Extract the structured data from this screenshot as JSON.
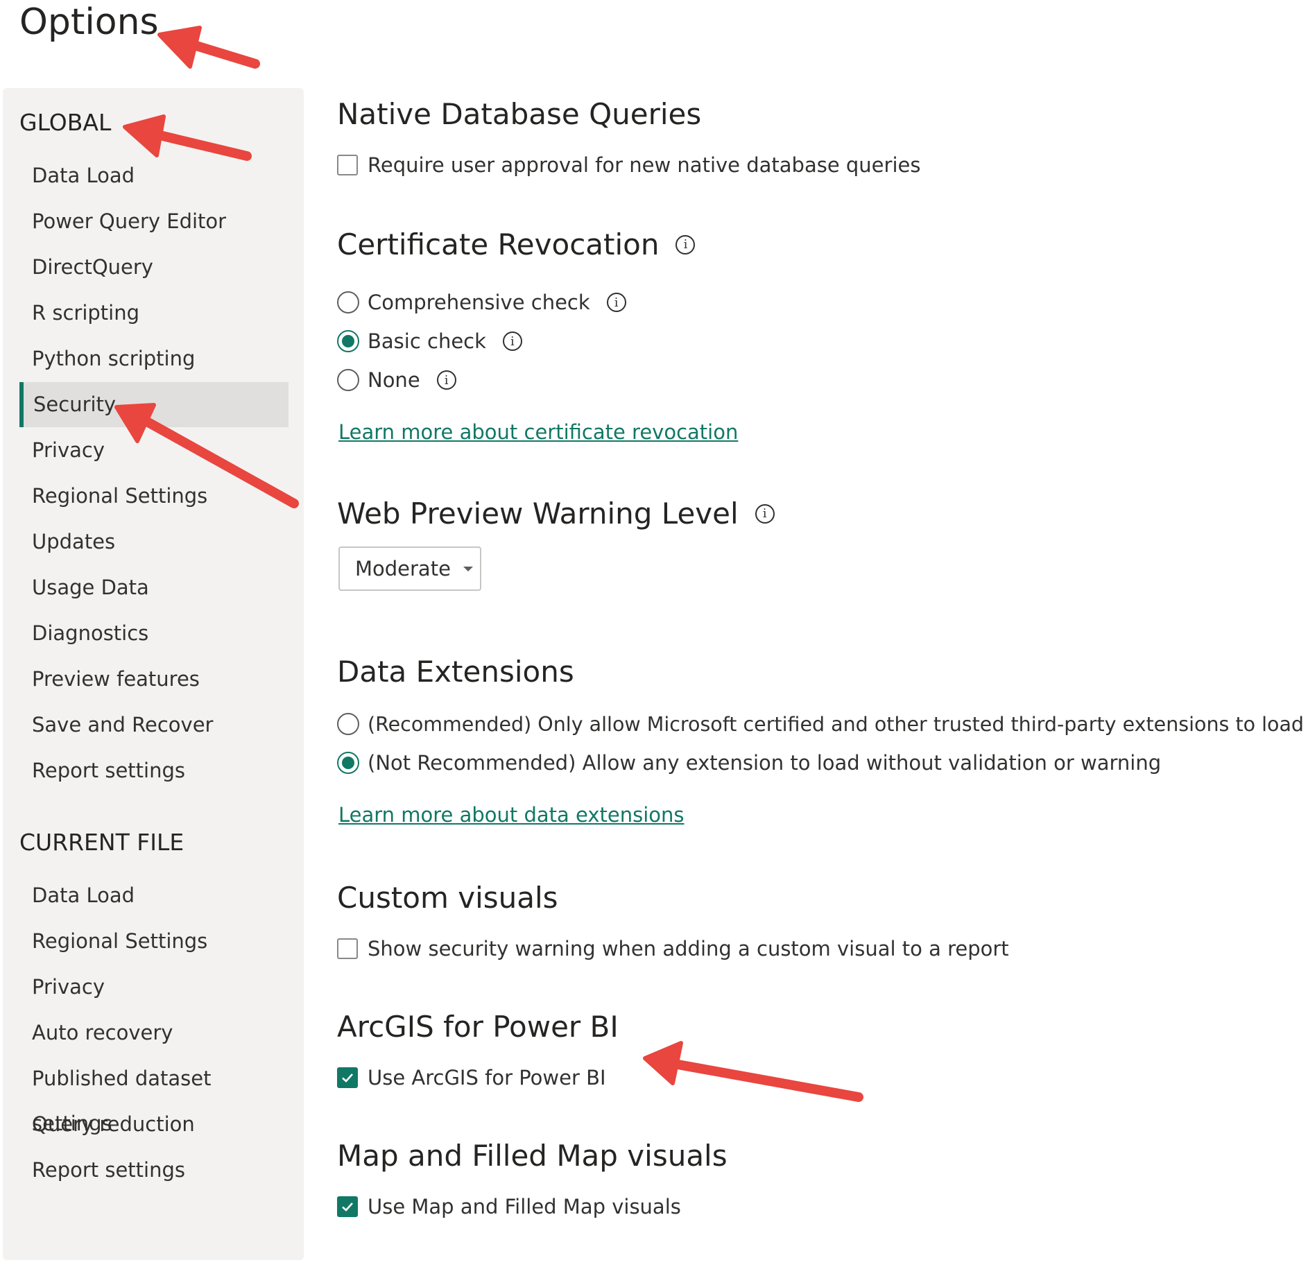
{
  "title": "Options",
  "sidebar": {
    "global_header": "GLOBAL",
    "global_items": [
      {
        "label": "Data Load"
      },
      {
        "label": "Power Query Editor"
      },
      {
        "label": "DirectQuery"
      },
      {
        "label": "R scripting"
      },
      {
        "label": "Python scripting"
      },
      {
        "label": "Security",
        "selected": true
      },
      {
        "label": "Privacy"
      },
      {
        "label": "Regional Settings"
      },
      {
        "label": "Updates"
      },
      {
        "label": "Usage Data"
      },
      {
        "label": "Diagnostics"
      },
      {
        "label": "Preview features"
      },
      {
        "label": "Save and Recover"
      },
      {
        "label": "Report settings"
      }
    ],
    "current_header": "CURRENT FILE",
    "current_items": [
      {
        "label": "Data Load"
      },
      {
        "label": "Regional Settings"
      },
      {
        "label": "Privacy"
      },
      {
        "label": "Auto recovery"
      },
      {
        "label": "Published dataset settings"
      },
      {
        "label": "Query reduction"
      },
      {
        "label": "Report settings"
      }
    ]
  },
  "native_db": {
    "heading": "Native Database Queries",
    "checkbox_label": "Require user approval for new native database queries",
    "checked": false
  },
  "cert": {
    "heading": "Certificate Revocation",
    "options": [
      {
        "label": "Comprehensive check",
        "selected": false
      },
      {
        "label": "Basic check",
        "selected": true
      },
      {
        "label": "None",
        "selected": false
      }
    ],
    "link": "Learn more about certificate revocation"
  },
  "web_preview": {
    "heading": "Web Preview Warning Level",
    "selected": "Moderate"
  },
  "data_ext": {
    "heading": "Data Extensions",
    "options": [
      {
        "label": "(Recommended) Only allow Microsoft certified and other trusted third-party extensions to load",
        "selected": false
      },
      {
        "label": "(Not Recommended) Allow any extension to load without validation or warning",
        "selected": true
      }
    ],
    "link": "Learn more about data extensions"
  },
  "custom_visuals": {
    "heading": "Custom visuals",
    "checkbox_label": "Show security warning when adding a custom visual to a report",
    "checked": false
  },
  "arcgis": {
    "heading": "ArcGIS for Power BI",
    "checkbox_label": "Use ArcGIS for Power BI",
    "checked": true
  },
  "map_visuals": {
    "heading": "Map and Filled Map visuals",
    "checkbox_label": "Use Map and Filled Map visuals",
    "checked": true
  },
  "colors": {
    "accent": "#117865",
    "annotation_arrow": "#e8463f",
    "sidebar_bg": "#f3f2f1",
    "selected_bg": "#e1dfdd"
  }
}
